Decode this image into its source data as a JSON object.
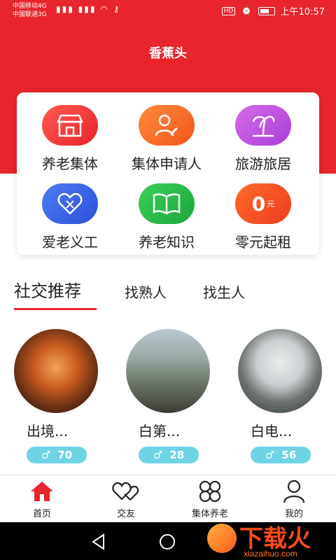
{
  "status_bar": {
    "carrier1": "中国移动4G",
    "carrier2": "中国联通3G",
    "hd": "HD",
    "time": "上午10:57"
  },
  "header": {
    "title": "香蕉头"
  },
  "features": [
    {
      "label": "养老集体",
      "icon": "store-icon",
      "color": "#e8242c"
    },
    {
      "label": "集体申请人",
      "icon": "user-edit-icon",
      "color": "#f0561c"
    },
    {
      "label": "旅游旅居",
      "icon": "palm-tree-icon",
      "color": "#a83fd6"
    },
    {
      "label": "爱老义工",
      "icon": "heart-icon",
      "color": "#2c4fd8"
    },
    {
      "label": "养老知识",
      "icon": "book-icon",
      "color": "#1ba63c"
    },
    {
      "label": "零元起租",
      "icon": "zero-yuan-icon",
      "color": "#ec3d1f",
      "icon_text": "0",
      "icon_unit": "元"
    }
  ],
  "social": {
    "tabs": [
      "社交推荐",
      "找熟人",
      "找生人"
    ],
    "active_tab": 0,
    "users": [
      {
        "name": "出境...",
        "gender": "♂",
        "age": "70"
      },
      {
        "name": "白第...",
        "gender": "♂",
        "age": "28"
      },
      {
        "name": "白电...",
        "gender": "♂",
        "age": "56"
      }
    ]
  },
  "tabbar": {
    "items": [
      {
        "label": "首页",
        "icon": "home-icon",
        "active": true
      },
      {
        "label": "交友",
        "icon": "hearts-icon",
        "active": false
      },
      {
        "label": "集体养老",
        "icon": "clover-icon",
        "active": false
      },
      {
        "label": "我的",
        "icon": "profile-icon",
        "active": false
      }
    ]
  },
  "watermark": {
    "main": "下载火",
    "sub": "xiazaihuo.com"
  },
  "colors": {
    "brand_red": "#e8242c",
    "badge": "#6fd3e6"
  }
}
